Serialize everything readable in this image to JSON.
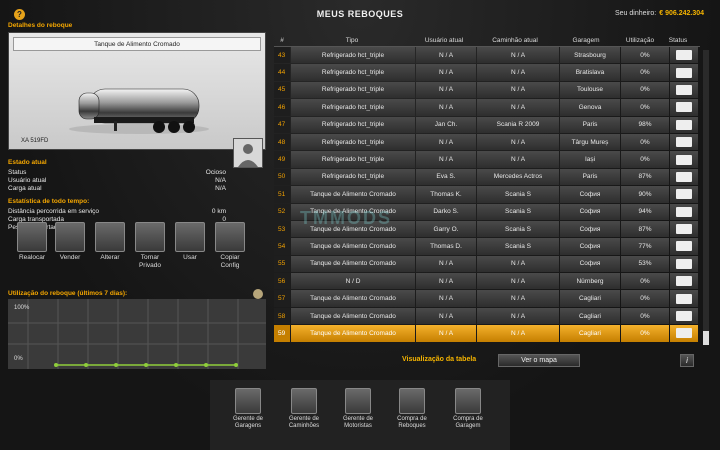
{
  "window": {
    "title": "MEUS REBOQUES",
    "money_label": "Seu dinheiro:",
    "money_value": "€ 906.242.304"
  },
  "details": {
    "section_title": "Detalhes do reboque",
    "trailer_name": "Tanque de Alimento Cromado",
    "plate": "XA 519FD",
    "state_title": "Estado atual",
    "status": {
      "label": "Status",
      "value": "Ocioso"
    },
    "current_user": {
      "label": "Usuário atual",
      "value": "N/A"
    },
    "current_cargo": {
      "label": "Carga atual",
      "value": "N/A"
    },
    "stats_title": "Estatística de todo tempo:",
    "distance": {
      "label": "Distância percorrida em serviço",
      "value": "0 km"
    },
    "transported": {
      "label": "Carga transportada",
      "value": "0"
    },
    "weight": {
      "label": "Peso transportado",
      "value": "0 t"
    }
  },
  "actions": [
    {
      "label": "Realocar",
      "icon": "relocate-icon"
    },
    {
      "label": "Vender",
      "icon": "sell-icon"
    },
    {
      "label": "Alterar",
      "icon": "change-icon"
    },
    {
      "label": "Tornar Privado",
      "icon": "private-icon"
    },
    {
      "label": "Usar",
      "icon": "use-icon"
    },
    {
      "label": "Copiar Config",
      "icon": "copy-config-icon"
    }
  ],
  "utilization": {
    "title": "Utilização do reboque (últimos 7 dias):",
    "max_label": "100%",
    "min_label": "0%"
  },
  "table": {
    "headers": [
      "#",
      "Tipo",
      "Usuário atual",
      "Caminhão atual",
      "Garagem",
      "Utilização",
      "Status"
    ],
    "rows": [
      {
        "n": "43",
        "type": "Refrigerado hct_triple",
        "user": "N / A",
        "truck": "N / A",
        "garage": "Strasbourg",
        "util": "0%"
      },
      {
        "n": "44",
        "type": "Refrigerado hct_triple",
        "user": "N / A",
        "truck": "N / A",
        "garage": "Bratislava",
        "util": "0%"
      },
      {
        "n": "45",
        "type": "Refrigerado hct_triple",
        "user": "N / A",
        "truck": "N / A",
        "garage": "Toulouse",
        "util": "0%"
      },
      {
        "n": "46",
        "type": "Refrigerado hct_triple",
        "user": "N / A",
        "truck": "N / A",
        "garage": "Genova",
        "util": "0%"
      },
      {
        "n": "47",
        "type": "Refrigerado hct_triple",
        "user": "Jan Ch.",
        "truck": "Scania R 2009",
        "garage": "Paris",
        "util": "98%"
      },
      {
        "n": "48",
        "type": "Refrigerado hct_triple",
        "user": "N / A",
        "truck": "N / A",
        "garage": "Târgu Mureș",
        "util": "0%"
      },
      {
        "n": "49",
        "type": "Refrigerado hct_triple",
        "user": "N / A",
        "truck": "N / A",
        "garage": "Iași",
        "util": "0%"
      },
      {
        "n": "50",
        "type": "Refrigerado hct_triple",
        "user": "Eva S.",
        "truck": "Mercedes Actros",
        "garage": "Paris",
        "util": "87%"
      },
      {
        "n": "51",
        "type": "Tanque de Alimento Cromado",
        "user": "Thomas K.",
        "truck": "Scania S",
        "garage": "София",
        "util": "90%"
      },
      {
        "n": "52",
        "type": "Tanque de Alimento Cromado",
        "user": "Darko S.",
        "truck": "Scania S",
        "garage": "София",
        "util": "94%"
      },
      {
        "n": "53",
        "type": "Tanque de Alimento Cromado",
        "user": "Garry O.",
        "truck": "Scania S",
        "garage": "София",
        "util": "87%"
      },
      {
        "n": "54",
        "type": "Tanque de Alimento Cromado",
        "user": "Thomas D.",
        "truck": "Scania S",
        "garage": "София",
        "util": "77%"
      },
      {
        "n": "55",
        "type": "Tanque de Alimento Cromado",
        "user": "N / A",
        "truck": "N / A",
        "garage": "София",
        "util": "53%"
      },
      {
        "n": "56",
        "type": "N / D",
        "user": "N / A",
        "truck": "N / A",
        "garage": "Nürnberg",
        "util": "0%"
      },
      {
        "n": "57",
        "type": "Tanque de Alimento Cromado",
        "user": "N / A",
        "truck": "N / A",
        "garage": "Cagliari",
        "util": "0%"
      },
      {
        "n": "58",
        "type": "Tanque de Alimento Cromado",
        "user": "N / A",
        "truck": "N / A",
        "garage": "Cagliari",
        "util": "0%"
      },
      {
        "n": "59",
        "type": "Tanque de Alimento Cromado",
        "user": "N / A",
        "truck": "N / A",
        "garage": "Cagliari",
        "util": "0%"
      }
    ]
  },
  "view": {
    "table_label": "Visualização da tabela",
    "map_button": "Ver o mapa",
    "info": "i"
  },
  "nav": [
    {
      "label": "Gerente de Garagens",
      "icon": "garage-manager-icon"
    },
    {
      "label": "Gerente de Caminhões",
      "icon": "truck-manager-icon"
    },
    {
      "label": "Gerente de Motoristas",
      "icon": "driver-manager-icon"
    },
    {
      "label": "Compra de Reboques",
      "icon": "buy-trailer-icon"
    },
    {
      "label": "Compra de Garagem",
      "icon": "buy-garage-icon"
    }
  ],
  "watermark": "TMMODS"
}
